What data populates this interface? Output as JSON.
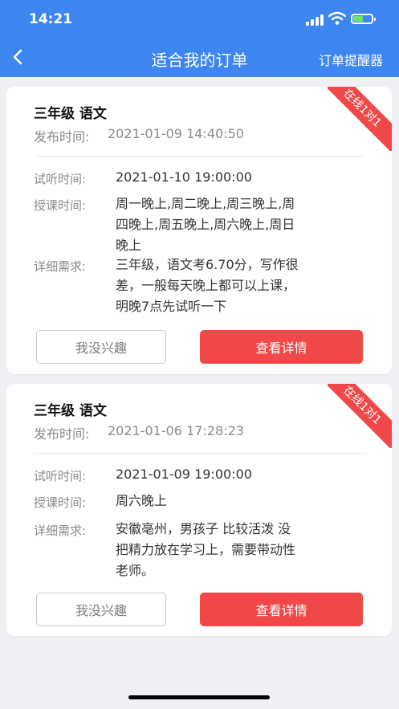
{
  "status_bar": {
    "time": "14:21"
  },
  "nav": {
    "title": "适合我的订单",
    "right_label": "订单提醒器"
  },
  "orders": [
    {
      "ribbon": "在线1对1",
      "title": "三年级 语文",
      "publish_label": "发布时间:",
      "publish_time": "2021-01-09 14:40:50",
      "trial_label": "试听时间:",
      "trial_time": "2021-01-10 19:00:00",
      "lesson_label": "授课时间:",
      "lesson_lines": [
        "周一晚上,周二晚上,周三晚上,周",
        "四晚上,周五晚上,周六晚上,周日",
        "晚上"
      ],
      "detail_label": "详细需求:",
      "detail_lines": [
        "三年级，语文考6.70分，写作很",
        "差，一般每天晚上都可以上课，",
        "明晚7点先试听一下"
      ],
      "not_interested": "我没兴趣",
      "view_details": "查看详情"
    },
    {
      "ribbon": "在线1对1",
      "title": "三年级 语文",
      "publish_label": "发布时间:",
      "publish_time": "2021-01-06 17:28:23",
      "trial_label": "试听时间:",
      "trial_time": "2021-01-09 19:00:00",
      "lesson_label": "授课时间:",
      "lesson_lines": [
        "周六晚上"
      ],
      "detail_label": "详细需求:",
      "detail_lines": [
        "安徽亳州，男孩子 比较活泼 没",
        "把精力放在学习上，需要带动性",
        "老师。"
      ],
      "not_interested": "我没兴趣",
      "view_details": "查看详情"
    }
  ]
}
